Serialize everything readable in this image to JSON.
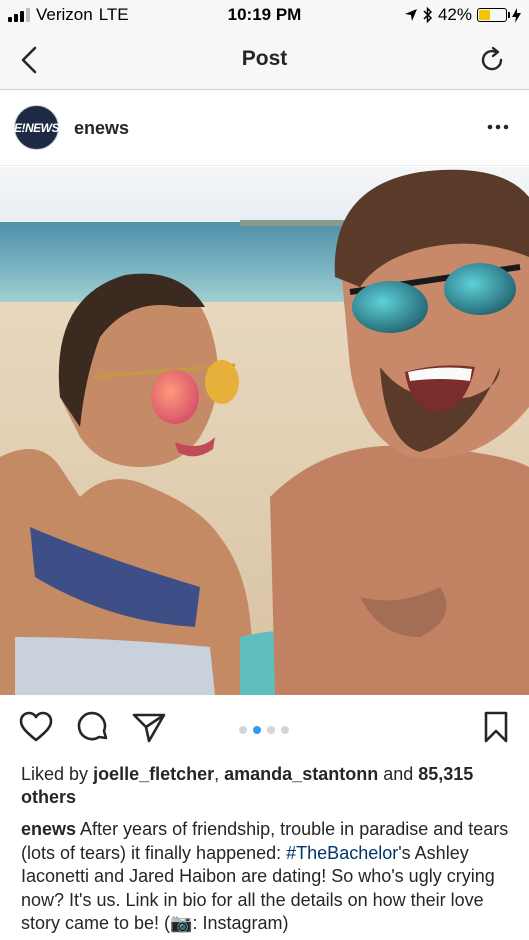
{
  "status_bar": {
    "carrier": "Verizon",
    "network": "LTE",
    "time": "10:19 PM",
    "battery_percent": "42%",
    "battery_level": 0.42
  },
  "nav": {
    "title": "Post",
    "back_icon": "chevron-left-icon",
    "refresh_icon": "refresh-icon"
  },
  "post": {
    "avatar_text": "E!NEWS",
    "username": "enews",
    "carousel": {
      "count": 4,
      "active_index": 1
    },
    "likes": {
      "prefix": "Liked by",
      "user1": "joelle_fletcher",
      "separator": ",",
      "user2": "amanda_stantonn",
      "conjunction": "and",
      "others": "85,315 others"
    },
    "caption": {
      "username": "enews",
      "text_before_tag": "After years of friendship, trouble in paradise and tears (lots of tears) it finally happened:",
      "hashtag": "#TheBachelor",
      "text_after_tag": "'s Ashley Iaconetti and Jared Haibon are dating! So who's ugly crying now? It's us. Link in bio for all the details on how their love story came to be! (📷: Instagram)"
    }
  },
  "colors": {
    "hashtag": "#003569",
    "active_dot": "#3897f0",
    "battery": "#f5c400"
  }
}
